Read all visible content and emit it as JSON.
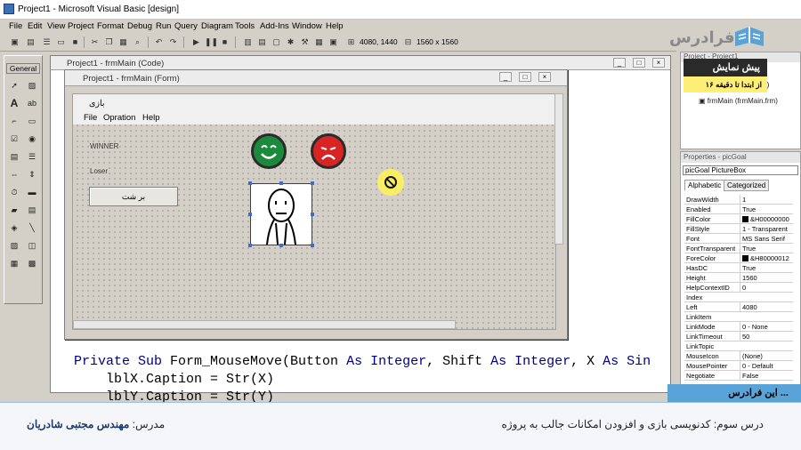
{
  "window": {
    "title": "Project1 - Microsoft Visual Basic [design]"
  },
  "logo": {
    "text": "فرادرس"
  },
  "menu": [
    "File",
    "Edit",
    "View",
    "Project",
    "Format",
    "Debug",
    "Run",
    "Query",
    "Diagram",
    "Tools",
    "Add-Ins",
    "Window",
    "Help"
  ],
  "toolbar": {
    "position_readout": "4080, 1440",
    "size_readout": "1560 x 1560"
  },
  "toolbox": {
    "header": "General"
  },
  "code_window": {
    "title": "Project1 - frmMain (Code)",
    "lines": [
      {
        "kw1": "Private Sub ",
        "t1": "Form_MouseMove(Button ",
        "kw2": "As Integer",
        "t2": ", Shift ",
        "kw3": "As Integer",
        "t3": ", X ",
        "kw4": "As Sin"
      },
      {
        "text": "    lblX.Caption = Str(X)"
      },
      {
        "text": "    lblY.Caption = Str(Y)"
      }
    ]
  },
  "form_designer": {
    "title": "Project1 - frmMain (Form)",
    "form_caption": "بازی",
    "form_menu": [
      "File",
      "Opration",
      "Help"
    ],
    "labels": {
      "winner": "WINNER",
      "loser": "Loser"
    },
    "back_button": "بر شت",
    "colors": {
      "happy_face": "#1c8a3c",
      "sad_face": "#d92424"
    }
  },
  "project_panel": {
    "header": "Project - Project1",
    "promo_title": "پیش نمایش",
    "promo_subtitle": "از ابتدا تا دقیقه ۱۶",
    "tree_item": "frmMain (frmMain.frm)",
    "tree_fragment": "t1)"
  },
  "properties_panel": {
    "header": "Properties - picGoal",
    "object": "picGoal PictureBox",
    "tabs": [
      "Alphabetic",
      "Categorized"
    ],
    "rows": [
      {
        "name": "DrawWidth",
        "value": "1"
      },
      {
        "name": "Enabled",
        "value": "True"
      },
      {
        "name": "FillColor",
        "value": "&H00000000",
        "swatch": "#000000"
      },
      {
        "name": "FillStyle",
        "value": "1 - Transparent"
      },
      {
        "name": "Font",
        "value": "MS Sans Serif"
      },
      {
        "name": "FontTransparent",
        "value": "True"
      },
      {
        "name": "ForeColor",
        "value": "&H80000012",
        "swatch": "#000000"
      },
      {
        "name": "HasDC",
        "value": "True"
      },
      {
        "name": "Height",
        "value": "1560"
      },
      {
        "name": "HelpContextID",
        "value": "0"
      },
      {
        "name": "Index",
        "value": ""
      },
      {
        "name": "Left",
        "value": "4080"
      },
      {
        "name": "LinkItem",
        "value": ""
      },
      {
        "name": "LinkMode",
        "value": "0 - None"
      },
      {
        "name": "LinkTimeout",
        "value": "50"
      },
      {
        "name": "LinkTopic",
        "value": ""
      },
      {
        "name": "MouseIcon",
        "value": "(None)"
      },
      {
        "name": "MousePointer",
        "value": "0 - Default"
      },
      {
        "name": "Negotiate",
        "value": "False"
      }
    ]
  },
  "overlay": {
    "blue_strip": "این فرادرس ...",
    "lesson": "درس سوم: کدنویسی بازی و افزودن امکانات جالب به پروژه",
    "teacher_label": "مدرس: ",
    "teacher_name": "مهندس مجتبی شادریان"
  }
}
